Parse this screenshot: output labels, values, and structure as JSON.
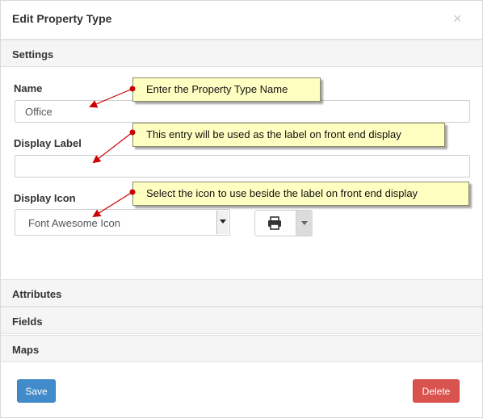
{
  "dialog": {
    "title": "Edit Property Type",
    "close_label": "×"
  },
  "sections": {
    "settings": "Settings",
    "attributes": "Attributes",
    "fields": "Fields",
    "maps": "Maps"
  },
  "form": {
    "name_label": "Name",
    "name_value": "Office",
    "display_label_label": "Display Label",
    "display_label_value": "",
    "display_icon_label": "Display Icon",
    "display_icon_selected": "Font Awesome Icon",
    "icon_picker_icon": "print-icon"
  },
  "callouts": {
    "name": "Enter the Property Type Name",
    "display_label": "This entry will be used as the label on front end display",
    "display_icon": "Select the icon to use beside the label on front end display"
  },
  "buttons": {
    "save": "Save",
    "delete": "Delete"
  },
  "colors": {
    "save": "#428bca",
    "delete": "#d9534f",
    "callout_bg": "#ffffc2",
    "arrow": "#cc0000"
  }
}
